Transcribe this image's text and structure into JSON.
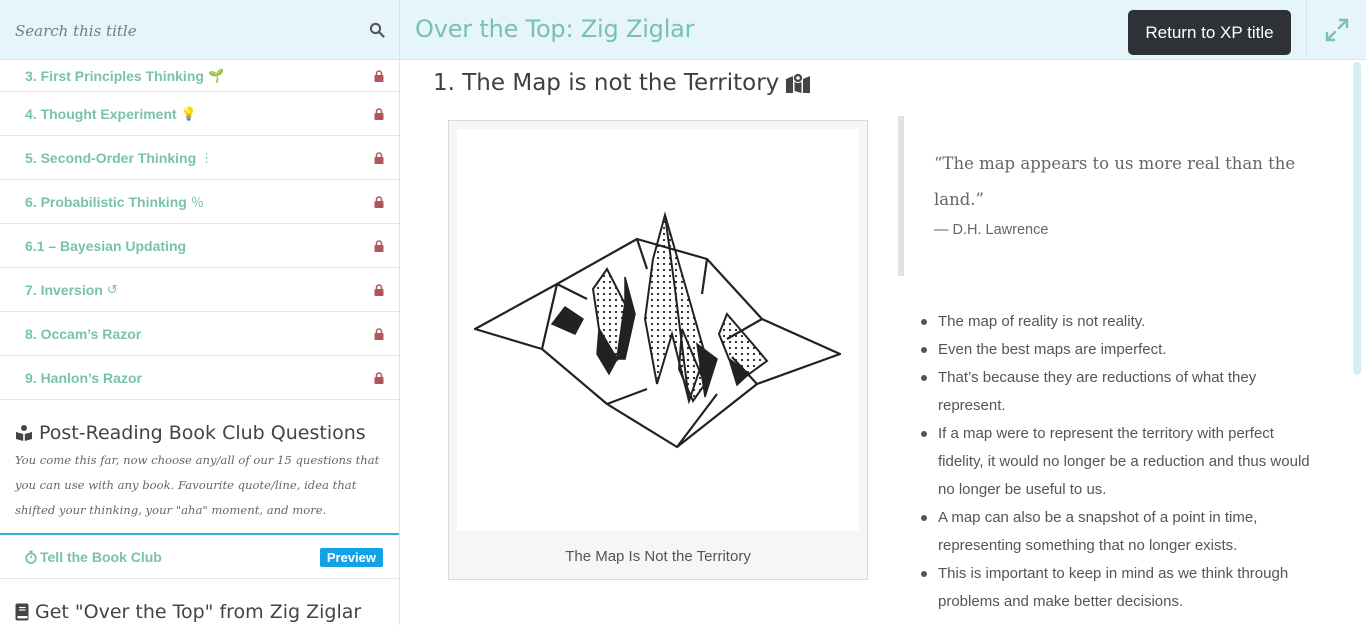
{
  "header": {
    "search_placeholder": "Search this title",
    "course_title": "Over the Top: Zig Ziglar",
    "return_button": "Return to XP title"
  },
  "sidebar": {
    "lessons": [
      {
        "label": "3. First Principles Thinking",
        "emoji": "🌱"
      },
      {
        "label": "4. Thought Experiment",
        "emoji": "💡"
      },
      {
        "label": "5. Second-Order Thinking",
        "emoji": "⋮"
      },
      {
        "label": "6. Probabilistic Thinking",
        "emoji": "％"
      },
      {
        "label": "6.1 – Bayesian Updating",
        "emoji": ""
      },
      {
        "label": "7. Inversion",
        "emoji": "↺"
      },
      {
        "label": "8. Occam’s Razor",
        "emoji": ""
      },
      {
        "label": "9. Hanlon’s Razor",
        "emoji": ""
      }
    ],
    "book_club": {
      "title": "Post-Reading Book Club Questions",
      "description": "You come this far, now choose any/all of our 15 questions that you can use with any book. Favourite quote/line, idea that shifted your thinking, your \"aha\" moment, and more.",
      "item_label": "Tell the Book Club",
      "badge": "Preview"
    },
    "get_section_title": "Get \"Over the Top\" from Zig Ziglar"
  },
  "main": {
    "lesson_title": "1. The Map is not the Territory",
    "figure_caption": "The Map Is Not the Territory",
    "quote": {
      "text": "“The map appears to us more real than the land.”",
      "author": "— D.H. Lawrence"
    },
    "bullets": [
      "The map of reality is not reality.",
      "Even the best maps are imperfect.",
      "That’s because they are reductions of what they represent.",
      "If a map were to represent the territory with perfect fidelity, it would no longer be a reduction and thus would no longer be useful to us.",
      "A map can also be a snapshot of a point in time, representing something that no longer exists.",
      "This is important to keep in mind as we think through problems and make better decisions."
    ]
  },
  "colors": {
    "accent_green": "#79c2ab",
    "header_bg": "#e6f4fb",
    "button_dark": "#2e3236",
    "lock_red": "#b0555c",
    "badge_blue": "#12a3e6"
  }
}
